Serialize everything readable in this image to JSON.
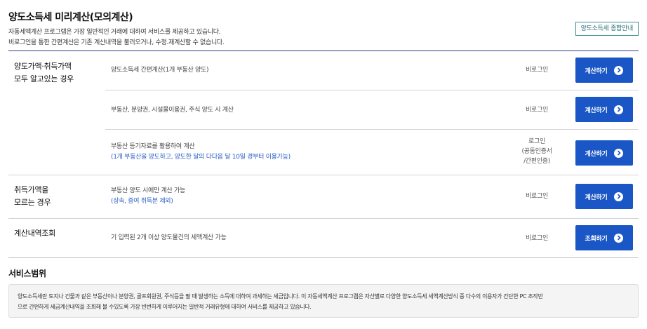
{
  "header": {
    "title": "양도소득세 미리계산(모의계산)",
    "desc_line1": "자동세액계산 프로그램은 가장 일반적인 거래에 대하여 서비스를 제공하고 있습니다.",
    "desc_line2": "비로그인을 통한 간편계산은 기존 계산내역을 불러오거나, 수정.재계산할 수 없습니다.",
    "guide_button": "양도소득세 종합안내"
  },
  "groups": [
    {
      "label_line1": "양도가액·취득가액",
      "label_line2": "모두 알고있는 경우",
      "items": [
        {
          "text": "양도소득세 간편계산(1개 부동산 양도)",
          "note": "",
          "status": "비로그인",
          "button": "계산하기"
        },
        {
          "text": "부동산, 분양권, 시설물이용권, 주식 양도 시 계산",
          "note": "",
          "status": "비로그인",
          "button": "계산하기"
        },
        {
          "text": "부동산 등기자료를 활용하여 계산",
          "note": "(1개 부동산을 양도하고, 양도한 달의 다다음 달 10일 경부터 이용가능)",
          "status_line1": "로그인",
          "status_line2": "(공동인증서",
          "status_line3": "/간편인증)",
          "button": "계산하기"
        }
      ]
    },
    {
      "label_line1": "취득가액을",
      "label_line2": "모르는 경우",
      "items": [
        {
          "text": "부동산 양도 시에만 계산 가능",
          "note": "(상속, 증여 취득분 제외)",
          "status": "비로그인",
          "button": "계산하기"
        }
      ]
    },
    {
      "label_line1": "계산내역조회",
      "items": [
        {
          "text": "기 입력된 2개 이상 양도물건의 세액계산 가능",
          "note": "",
          "status": "비로그인",
          "button": "조회하기"
        }
      ]
    }
  ],
  "scope": {
    "title": "서비스범위",
    "line1": "양도소득세란 토지나 건물과 같은 부동산이나 분양권, 골프회원권, 주식등을 팔 때 발생하는 소득에 대하여 과세하는 세금입니다. 이 자동세액계산 프로그램은 자산별로 다양한 양도소득세 세액계산방식 중 다수의 이용자가 간단한 PC 조작만",
    "line2": "으로 간편하게 세금계산내역을 조회해 볼 수있도록 가장 빈번하게 이루어지는 일반적 거래유형에 대하여 서비스를 제공하고 있습니다."
  },
  "colors": {
    "button_bg": "#1a56c5",
    "note_text": "#2c5fc4",
    "top_rule": "#2b3f8c",
    "guide_border": "#3d8f93"
  },
  "icons": {
    "button_arrow": "chevron-right-circle-icon"
  }
}
